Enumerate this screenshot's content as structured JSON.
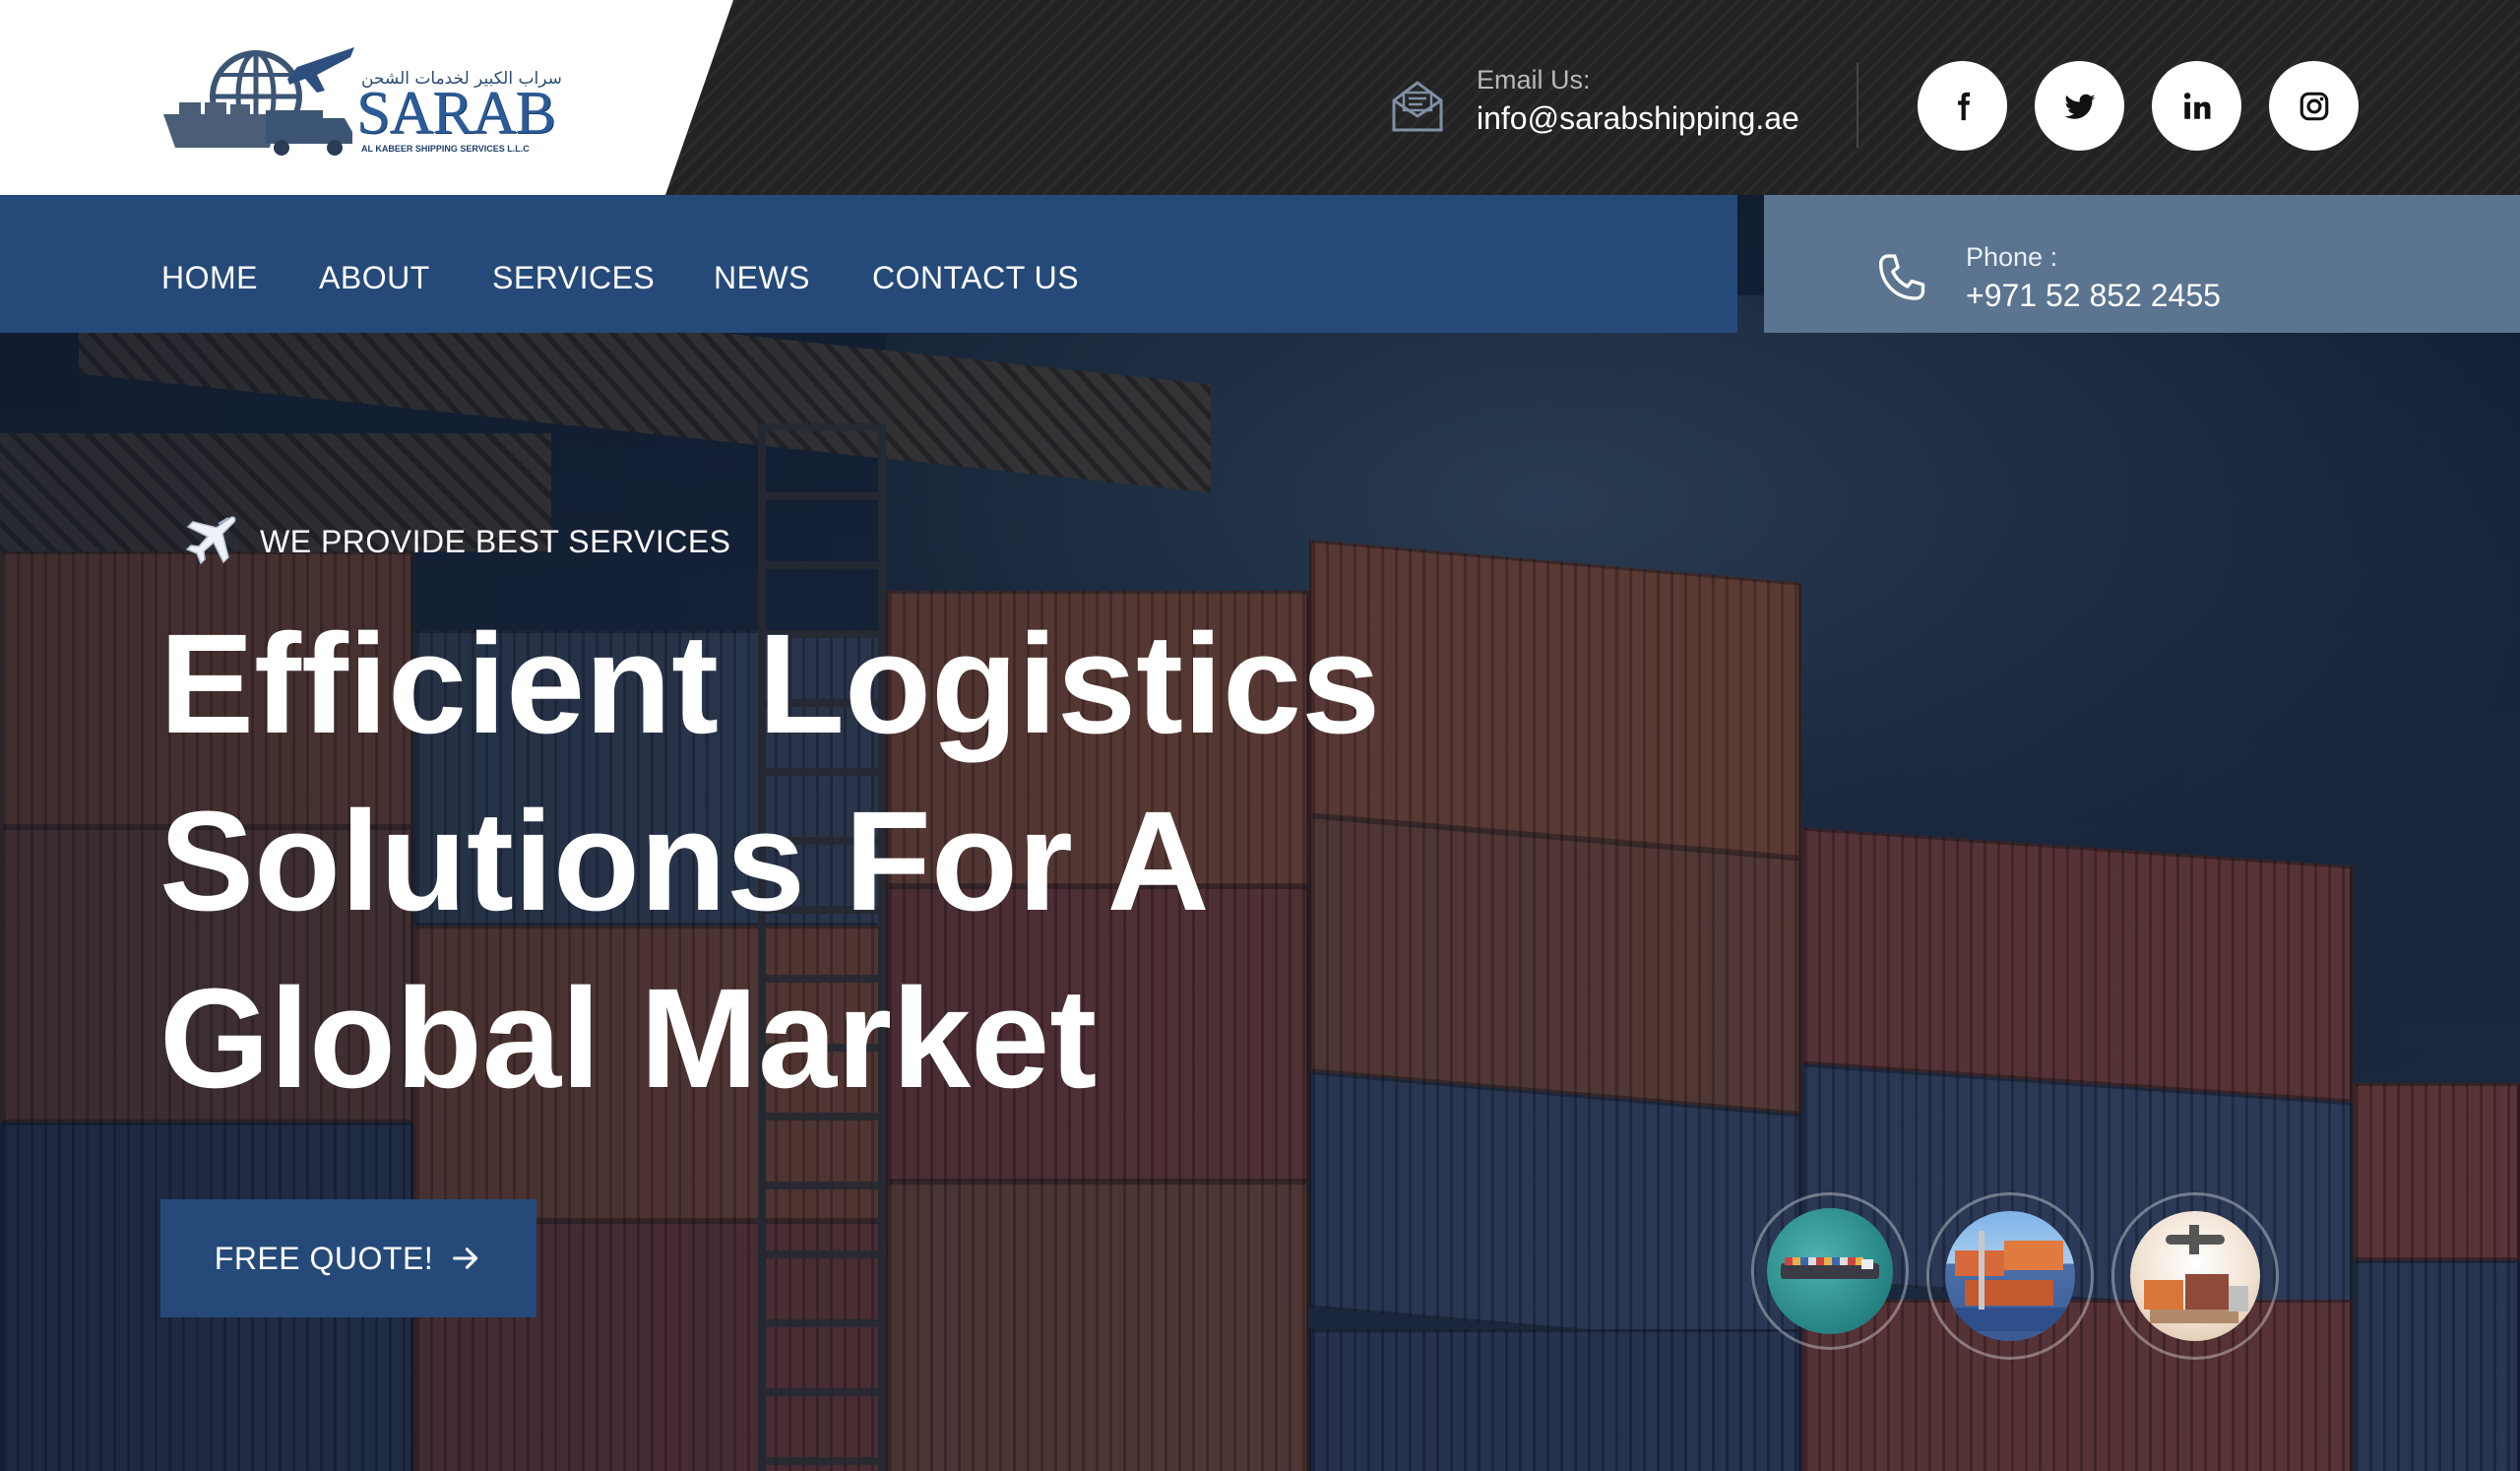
{
  "brand": {
    "name": "SARAB",
    "arabic_name": "سراب الكبير لخدمات الشحن",
    "subtitle": "AL KABEER SHIPPING SERVICES L.L.C"
  },
  "contact": {
    "email_label": "Email Us:",
    "email": "info@sarabshipping.ae",
    "phone_label": "Phone :",
    "phone": "+971 52 852 2455"
  },
  "social": [
    {
      "icon": "facebook-icon"
    },
    {
      "icon": "twitter-icon"
    },
    {
      "icon": "linkedin-icon"
    },
    {
      "icon": "instagram-icon"
    }
  ],
  "nav": {
    "items": [
      {
        "label": "HOME"
      },
      {
        "label": "ABOUT"
      },
      {
        "label": "SERVICES"
      },
      {
        "label": "NEWS"
      },
      {
        "label": "CONTACT US"
      }
    ]
  },
  "hero": {
    "tagline": "WE PROVIDE BEST SERVICES",
    "title_lines": [
      "Efficient Logistics",
      "Solutions For A",
      "Global Market"
    ],
    "cta_label": "FREE QUOTE!"
  },
  "thumbnails": [
    {
      "icon": "cargo-ship-thumbnail"
    },
    {
      "icon": "containers-thumbnail"
    },
    {
      "icon": "air-freight-thumbnail"
    }
  ],
  "colors": {
    "primary": "#254a79",
    "phone_box": "#5b7590",
    "topbar": "#232323"
  }
}
